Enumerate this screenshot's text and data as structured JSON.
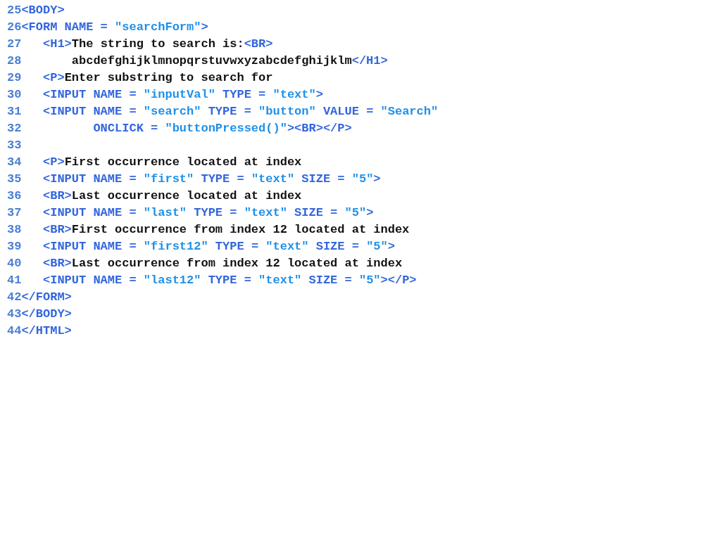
{
  "code_lines": [
    {
      "number": "25",
      "segments": [
        {
          "kind": "tag",
          "text": "<BODY>"
        }
      ]
    },
    {
      "number": "26",
      "segments": [
        {
          "kind": "tag",
          "text": "<FORM NAME = "
        },
        {
          "kind": "string",
          "text": "\"searchForm\""
        },
        {
          "kind": "tag",
          "text": ">"
        }
      ]
    },
    {
      "number": "27",
      "segments": [
        {
          "kind": "tag",
          "text": "   <H1>"
        },
        {
          "kind": "text",
          "text": "The string to search is:"
        },
        {
          "kind": "tag",
          "text": "<BR>"
        }
      ]
    },
    {
      "number": "28",
      "segments": [
        {
          "kind": "text",
          "text": "       abcdefghijklmnopqrstuvwxyzabcdefghijklm"
        },
        {
          "kind": "tag",
          "text": "</H1>"
        }
      ]
    },
    {
      "number": "29",
      "segments": [
        {
          "kind": "tag",
          "text": "   <P>"
        },
        {
          "kind": "text",
          "text": "Enter substring to search for"
        }
      ]
    },
    {
      "number": "30",
      "segments": [
        {
          "kind": "tag",
          "text": "   <INPUT NAME = "
        },
        {
          "kind": "string",
          "text": "\"inputVal\""
        },
        {
          "kind": "tag",
          "text": " TYPE = "
        },
        {
          "kind": "string",
          "text": "\"text\""
        },
        {
          "kind": "tag",
          "text": ">"
        }
      ]
    },
    {
      "number": "31",
      "segments": [
        {
          "kind": "tag",
          "text": "   <INPUT NAME = "
        },
        {
          "kind": "string",
          "text": "\"search\""
        },
        {
          "kind": "tag",
          "text": " TYPE = "
        },
        {
          "kind": "string",
          "text": "\"button\""
        },
        {
          "kind": "tag",
          "text": " VALUE = "
        },
        {
          "kind": "string",
          "text": "\"Search\""
        }
      ]
    },
    {
      "number": "32",
      "segments": [
        {
          "kind": "tag",
          "text": "          ONCLICK = "
        },
        {
          "kind": "string",
          "text": "\"buttonPressed()\""
        },
        {
          "kind": "tag",
          "text": "><BR></P>"
        }
      ]
    },
    {
      "number": "33"
    },
    {
      "number": "34",
      "segments": [
        {
          "kind": "tag",
          "text": "   <P>"
        },
        {
          "kind": "text",
          "text": "First occurrence located at index"
        }
      ]
    },
    {
      "number": "35",
      "segments": [
        {
          "kind": "tag",
          "text": "   <INPUT NAME = "
        },
        {
          "kind": "string",
          "text": "\"first\""
        },
        {
          "kind": "tag",
          "text": " TYPE = "
        },
        {
          "kind": "string",
          "text": "\"text\""
        },
        {
          "kind": "tag",
          "text": " SIZE = "
        },
        {
          "kind": "string",
          "text": "\"5\""
        },
        {
          "kind": "tag",
          "text": ">"
        }
      ]
    },
    {
      "number": "36",
      "segments": [
        {
          "kind": "tag",
          "text": "   <BR>"
        },
        {
          "kind": "text",
          "text": "Last occurrence located at index"
        }
      ]
    },
    {
      "number": "37",
      "segments": [
        {
          "kind": "tag",
          "text": "   <INPUT NAME = "
        },
        {
          "kind": "string",
          "text": "\"last\""
        },
        {
          "kind": "tag",
          "text": " TYPE = "
        },
        {
          "kind": "string",
          "text": "\"text\""
        },
        {
          "kind": "tag",
          "text": " SIZE = "
        },
        {
          "kind": "string",
          "text": "\"5\""
        },
        {
          "kind": "tag",
          "text": ">"
        }
      ]
    },
    {
      "number": "38",
      "segments": [
        {
          "kind": "tag",
          "text": "   <BR>"
        },
        {
          "kind": "text",
          "text": "First occurrence from index 12 located at index"
        }
      ]
    },
    {
      "number": "39",
      "segments": [
        {
          "kind": "tag",
          "text": "   <INPUT NAME = "
        },
        {
          "kind": "string",
          "text": "\"first12\""
        },
        {
          "kind": "tag",
          "text": " TYPE = "
        },
        {
          "kind": "string",
          "text": "\"text\""
        },
        {
          "kind": "tag",
          "text": " SIZE = "
        },
        {
          "kind": "string",
          "text": "\"5\""
        },
        {
          "kind": "tag",
          "text": ">"
        }
      ]
    },
    {
      "number": "40",
      "segments": [
        {
          "kind": "tag",
          "text": "   <BR>"
        },
        {
          "kind": "text",
          "text": "Last occurrence from index 12 located at index"
        }
      ]
    },
    {
      "number": "41",
      "segments": [
        {
          "kind": "tag",
          "text": "   <INPUT NAME = "
        },
        {
          "kind": "string",
          "text": "\"last12\""
        },
        {
          "kind": "tag",
          "text": " TYPE = "
        },
        {
          "kind": "string",
          "text": "\"text\""
        },
        {
          "kind": "tag",
          "text": " SIZE = "
        },
        {
          "kind": "string",
          "text": "\"5\""
        },
        {
          "kind": "tag",
          "text": "></P>"
        }
      ]
    },
    {
      "number": "42",
      "segments": [
        {
          "kind": "tag",
          "text": "</FORM>"
        }
      ]
    },
    {
      "number": "43",
      "segments": [
        {
          "kind": "tag",
          "text": "</BODY>"
        }
      ]
    },
    {
      "number": "44",
      "segments": [
        {
          "kind": "tag",
          "text": "</HTML>"
        }
      ]
    }
  ]
}
